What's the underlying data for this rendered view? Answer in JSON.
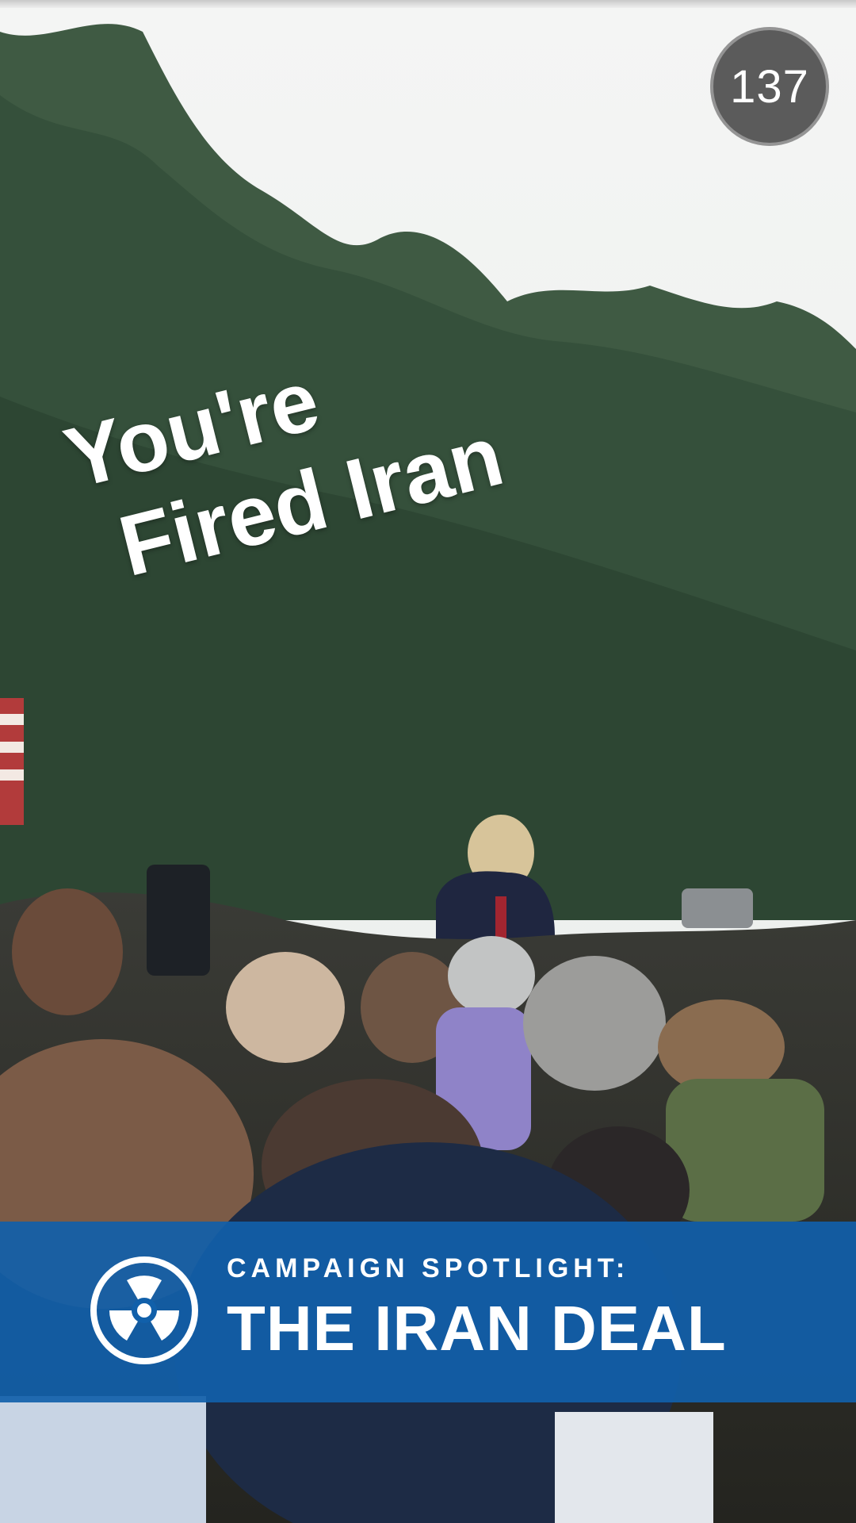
{
  "story": {
    "timer_value": "137",
    "caption_line1": "You're",
    "caption_line2": "Fired Iran"
  },
  "banner": {
    "kicker": "CAMPAIGN SPOTLIGHT:",
    "headline": "THE IRAN DEAL",
    "icon": "radiation-icon",
    "background_color": "#1160aa"
  }
}
